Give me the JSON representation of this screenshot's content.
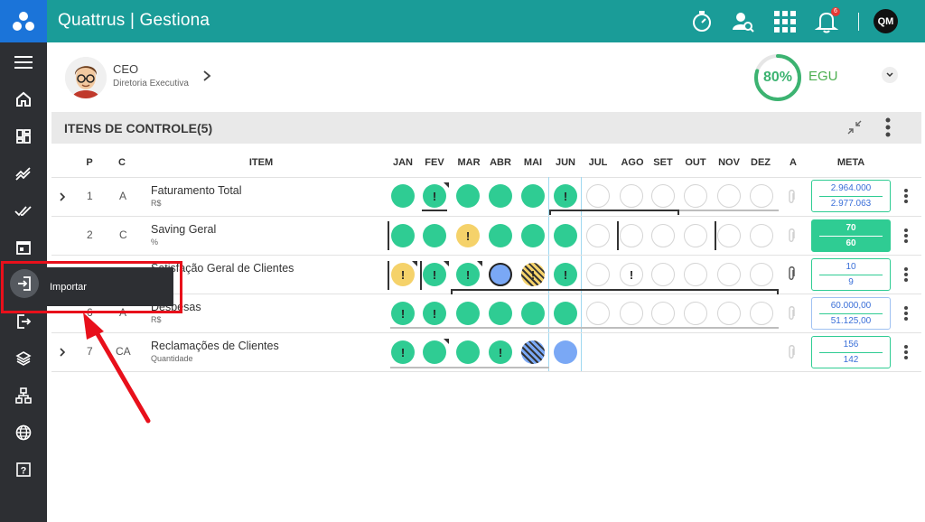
{
  "app": {
    "title": "Quattrus | Gestiona"
  },
  "topbar": {
    "notif_count": "6",
    "user_initials": "QM"
  },
  "header": {
    "role": "CEO",
    "department": "Diretoria Executiva",
    "score": "80%",
    "score_fraction": 0.8,
    "unit_code": "EGU"
  },
  "section": {
    "title": "ITENS DE CONTROLE(5)"
  },
  "columns": {
    "p": "P",
    "c": "C",
    "item": "ITEM",
    "months": [
      "JAN",
      "FEV",
      "MAR",
      "ABR",
      "MAI",
      "JUN",
      "JUL",
      "AGO",
      "SET",
      "OUT",
      "NOV",
      "DEZ"
    ],
    "a": "A",
    "meta": "META"
  },
  "rows": [
    {
      "p": "1",
      "c": "A",
      "name": "Faturamento Total",
      "unit": "R$",
      "meta_target": "2.964.000",
      "meta_actual": "2.977.063"
    },
    {
      "p": "2",
      "c": "C",
      "name": "Saving Geral",
      "unit": "%",
      "meta_target": "70",
      "meta_actual": "60"
    },
    {
      "p": "",
      "c": "",
      "name": "Satisfação Geral de Clientes",
      "unit": "",
      "meta_target": "10",
      "meta_actual": "9"
    },
    {
      "p": "6",
      "c": "A",
      "name": "Despesas",
      "unit": "R$",
      "meta_target": "60.000,00",
      "meta_actual": "51.125,00"
    },
    {
      "p": "7",
      "c": "CA",
      "name": "Reclamações de Clientes",
      "unit": "Quantidade",
      "meta_target": "156",
      "meta_actual": "142"
    }
  ],
  "tooltip": {
    "label": "Importar"
  },
  "colors": {
    "teal": "#1a9c98",
    "brand_blue": "#1b74d9",
    "status_green": "#2fcc93",
    "status_yellow": "#f5d26a",
    "status_blue": "#7aa8f5",
    "annotation_red": "#e8101b"
  },
  "icons": {
    "sidebar": [
      "menu-icon",
      "home-icon",
      "dashboard-icon",
      "trend-icon",
      "check-all-icon",
      "calendar-icon",
      "import-icon",
      "export-icon",
      "layers-icon",
      "hierarchy-icon",
      "globe-icon",
      "help-icon"
    ],
    "topbar": [
      "timer-icon",
      "user-search-icon",
      "apps-grid-icon",
      "bell-icon"
    ]
  }
}
